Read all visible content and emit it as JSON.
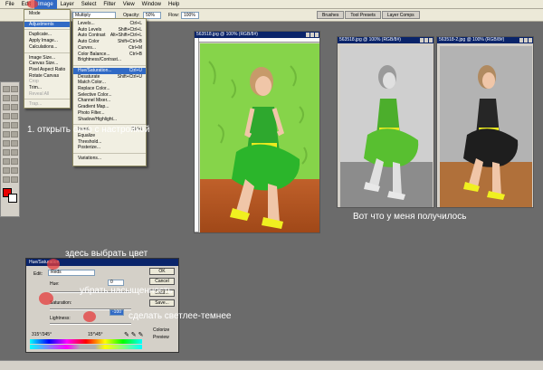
{
  "menubar": {
    "items": [
      "File",
      "Edit",
      "Image",
      "Layer",
      "Select",
      "Filter",
      "View",
      "Window",
      "Help"
    ],
    "active_index": 2
  },
  "options_bar": {
    "mode_value": "Multiply",
    "opacity_label": "Opacity:",
    "opacity_value": "50%",
    "flow_label": "Flow:",
    "flow_value": "100%"
  },
  "palette_tabs": [
    "Brushes",
    "Tool Presets",
    "Layer Comps"
  ],
  "image_menu": {
    "items": [
      {
        "label": "Mode",
        "shortcut": "",
        "state": "normal"
      },
      {
        "label": "Adjustments",
        "shortcut": "",
        "state": "highlight"
      },
      {
        "label": "Duplicate...",
        "shortcut": "",
        "state": "normal"
      },
      {
        "label": "Apply Image...",
        "shortcut": "",
        "state": "normal"
      },
      {
        "label": "Calculations...",
        "shortcut": "",
        "state": "normal"
      },
      {
        "label": "Image Size...",
        "shortcut": "",
        "state": "normal"
      },
      {
        "label": "Canvas Size...",
        "shortcut": "",
        "state": "normal"
      },
      {
        "label": "Pixel Aspect Ratio",
        "shortcut": "",
        "state": "normal"
      },
      {
        "label": "Rotate Canvas",
        "shortcut": "",
        "state": "normal"
      },
      {
        "label": "Crop",
        "shortcut": "",
        "state": "disabled"
      },
      {
        "label": "Trim...",
        "shortcut": "",
        "state": "normal"
      },
      {
        "label": "Reveal All",
        "shortcut": "",
        "state": "disabled"
      },
      {
        "label": "Trap...",
        "shortcut": "",
        "state": "disabled"
      }
    ]
  },
  "adjustments_menu": {
    "items": [
      {
        "label": "Levels...",
        "shortcut": "Ctrl+L",
        "state": "normal"
      },
      {
        "label": "Auto Levels",
        "shortcut": "Shift+Ctrl+L",
        "state": "normal"
      },
      {
        "label": "Auto Contrast",
        "shortcut": "Alt+Shift+Ctrl+L",
        "state": "normal"
      },
      {
        "label": "Auto Color",
        "shortcut": "Shift+Ctrl+B",
        "state": "normal"
      },
      {
        "label": "Curves...",
        "shortcut": "Ctrl+M",
        "state": "normal"
      },
      {
        "label": "Color Balance...",
        "shortcut": "Ctrl+B",
        "state": "normal"
      },
      {
        "label": "Brightness/Contrast...",
        "shortcut": "",
        "state": "normal"
      },
      {
        "label": "Hue/Saturation...",
        "shortcut": "Ctrl+U",
        "state": "highlight"
      },
      {
        "label": "Desaturate",
        "shortcut": "Shift+Ctrl+U",
        "state": "normal"
      },
      {
        "label": "Match Color...",
        "shortcut": "",
        "state": "normal"
      },
      {
        "label": "Replace Color...",
        "shortcut": "",
        "state": "normal"
      },
      {
        "label": "Selective Color...",
        "shortcut": "",
        "state": "normal"
      },
      {
        "label": "Channel Mixer...",
        "shortcut": "",
        "state": "normal"
      },
      {
        "label": "Gradient Map...",
        "shortcut": "",
        "state": "normal"
      },
      {
        "label": "Photo Filter...",
        "shortcut": "",
        "state": "normal"
      },
      {
        "label": "Shadow/Highlight...",
        "shortcut": "",
        "state": "normal"
      },
      {
        "label": "Invert",
        "shortcut": "Ctrl+I",
        "state": "normal"
      },
      {
        "label": "Equalize",
        "shortcut": "",
        "state": "normal"
      },
      {
        "label": "Threshold...",
        "shortcut": "",
        "state": "normal"
      },
      {
        "label": "Posterize...",
        "shortcut": "",
        "state": "normal"
      },
      {
        "label": "Variations...",
        "shortcut": "",
        "state": "normal"
      }
    ]
  },
  "docs": {
    "main_title": "563518.jpg @ 100% (RGB/8#)",
    "left_title": "563518.jpg @ 100% (RGB/8#)",
    "right_title": "563518-2.jpg @ 100% (RGB/8#)"
  },
  "annotations": {
    "step1": "1. открыть окно с настройкой",
    "result": "Вот что у меня получилось",
    "choose_color": "здесь выбрать цвет",
    "remove_saturation": "убрать насыщенность",
    "lighter_darker": "сделать светлее-темнее"
  },
  "hue_dialog": {
    "title": "Hue/Saturation",
    "edit_label": "Edit:",
    "edit_value": "Reds",
    "hue_label": "Hue:",
    "hue_value": "0",
    "saturation_label": "Saturation:",
    "saturation_value": "-100",
    "lightness_label": "Lightness:",
    "lightness_value": "0",
    "ok_label": "OK",
    "cancel_label": "Cancel",
    "load_label": "Load...",
    "save_label": "Save...",
    "colorize_label": "Colorize",
    "preview_label": "Preview",
    "range_left": "315°/345°",
    "range_right": "15°\\45°"
  },
  "colors": {
    "foreground": "#e80000",
    "highlight": "#316ac5",
    "titlebar": "#0a246a",
    "annotation_dot": "#e63c3c"
  }
}
